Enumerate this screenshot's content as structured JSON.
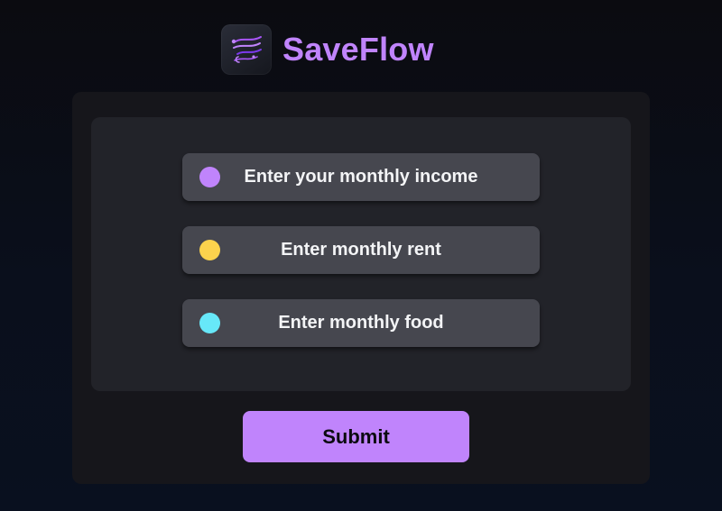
{
  "brand": {
    "logo_icon": "flow-lines-logo-icon",
    "name": "SaveFlow",
    "accent_color": "#c084fc"
  },
  "form": {
    "fields": [
      {
        "placeholder": "Enter your monthly income",
        "dot_color": "#c084fc"
      },
      {
        "placeholder": "Enter monthly rent",
        "dot_color": "#fcd34d"
      },
      {
        "placeholder": "Enter monthly food",
        "dot_color": "#67e8f9"
      }
    ],
    "submit_label": "Submit"
  }
}
